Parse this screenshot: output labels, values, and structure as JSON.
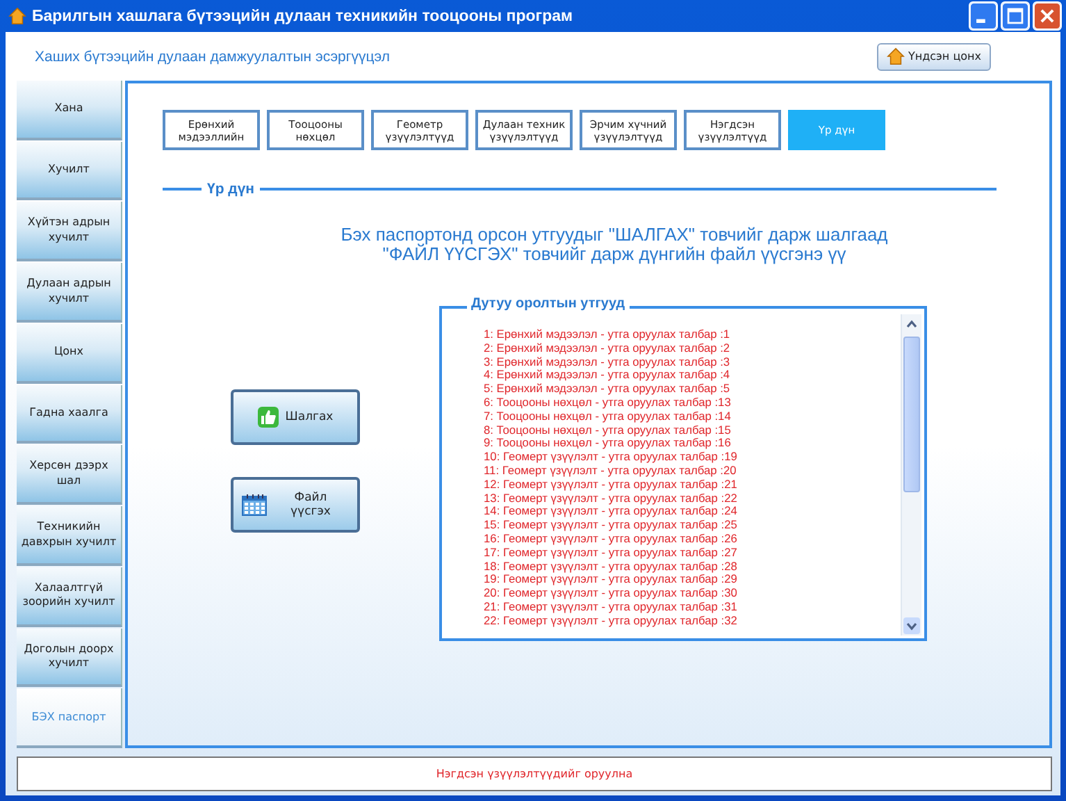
{
  "window": {
    "title": "Барилгын хашлага бүтээцийн дулаан техникийн тооцооны програм"
  },
  "header": {
    "title": "Хаших бүтээцийн дулаан дамжуулалтын эсэргүүцэл",
    "home_button": "Үндсэн цонх"
  },
  "sidebar": {
    "items": [
      {
        "label": "Хана",
        "selected": false
      },
      {
        "label": "Хучилт",
        "selected": false
      },
      {
        "label": "Хүйтэн адрын хучилт",
        "selected": false
      },
      {
        "label": "Дулаан адрын хучилт",
        "selected": false
      },
      {
        "label": "Цонх",
        "selected": false
      },
      {
        "label": "Гадна хаалга",
        "selected": false
      },
      {
        "label": "Херсөн дээрх шал",
        "selected": false
      },
      {
        "label": "Техникийн давхрын хучилт",
        "selected": false
      },
      {
        "label": "Халаалтгүй зоорийн хучилт",
        "selected": false
      },
      {
        "label": "Доголын доорх хучилт",
        "selected": false
      },
      {
        "label": "БЭХ паспорт",
        "selected": true
      }
    ]
  },
  "tabs": [
    {
      "label": "Ерөнхий мэдээллийн",
      "selected": false
    },
    {
      "label": "Тооцооны нөхцөл",
      "selected": false
    },
    {
      "label": "Геометр үзүүлэлтүүд",
      "selected": false
    },
    {
      "label": "Дулаан техник үзүүлэлтүүд",
      "selected": false
    },
    {
      "label": "Эрчим хүчний үзүүлэлтүүд",
      "selected": false
    },
    {
      "label": "Нэгдсэн үзүүлэлтүүд",
      "selected": false
    },
    {
      "label": "Үр дүн",
      "selected": true
    }
  ],
  "section": {
    "title": "Үр дүн",
    "message": "Бэх паспортонд орсон утгуудыг \"ШАЛГАХ\" товчийг дарж шалгаад \"ФАЙЛ ҮҮСГЭХ\" товчийг дарж дүнгийн файл үүсгэнэ үү"
  },
  "buttons": [
    {
      "label": "Шалгах",
      "kind": "check"
    },
    {
      "label": "Файл үүсгэх",
      "kind": "calendar"
    }
  ],
  "missing_values": {
    "title": "Дутуу оролтын утгууд",
    "items": [
      "1: Ерөнхий мэдээлэл - утга оруулах талбар :1",
      "2: Ерөнхий мэдээлэл - утга оруулах талбар :2",
      "3: Ерөнхий мэдээлэл - утга оруулах талбар :3",
      "4: Ерөнхий мэдээлэл - утга оруулах талбар :4",
      "5: Ерөнхий мэдээлэл - утга оруулах талбар :5",
      "6: Тооцооны нөхцөл - утга оруулах талбар :13",
      "7: Тооцооны нөхцөл - утга оруулах талбар :14",
      "8: Тооцооны нөхцөл - утга оруулах талбар :15",
      "9: Тооцооны нөхцөл - утга оруулах талбар :16",
      "10: Геомерт үзүүлэлт - утга оруулах талбар :19",
      "11: Геомерт үзүүлэлт - утга оруулах талбар :20",
      "12: Геомерт үзүүлэлт - утга оруулах талбар :21",
      "13: Геомерт үзүүлэлт - утга оруулах талбар :22",
      "14: Геомерт үзүүлэлт - утга оруулах талбар :24",
      "15: Геомерт үзүүлэлт - утга оруулах талбар :25",
      "16: Геомерт үзүүлэлт - утга оруулах талбар :26",
      "17: Геомерт үзүүлэлт - утга оруулах талбар :27",
      "18: Геомерт үзүүлэлт - утга оруулах талбар :28",
      "19: Геомерт үзүүлэлт - утга оруулах талбар :29",
      "20: Геомерт үзүүлэлт - утга оруулах талбар :30",
      "21: Геомерт үзүүлэлт - утга оруулах талбар :31",
      "22: Геомерт үзүүлэлт - утга оруулах талбар :32"
    ]
  },
  "status_bar": {
    "text": "Нэгдсэн үзүүлэлтүүдийг оруулна"
  }
}
